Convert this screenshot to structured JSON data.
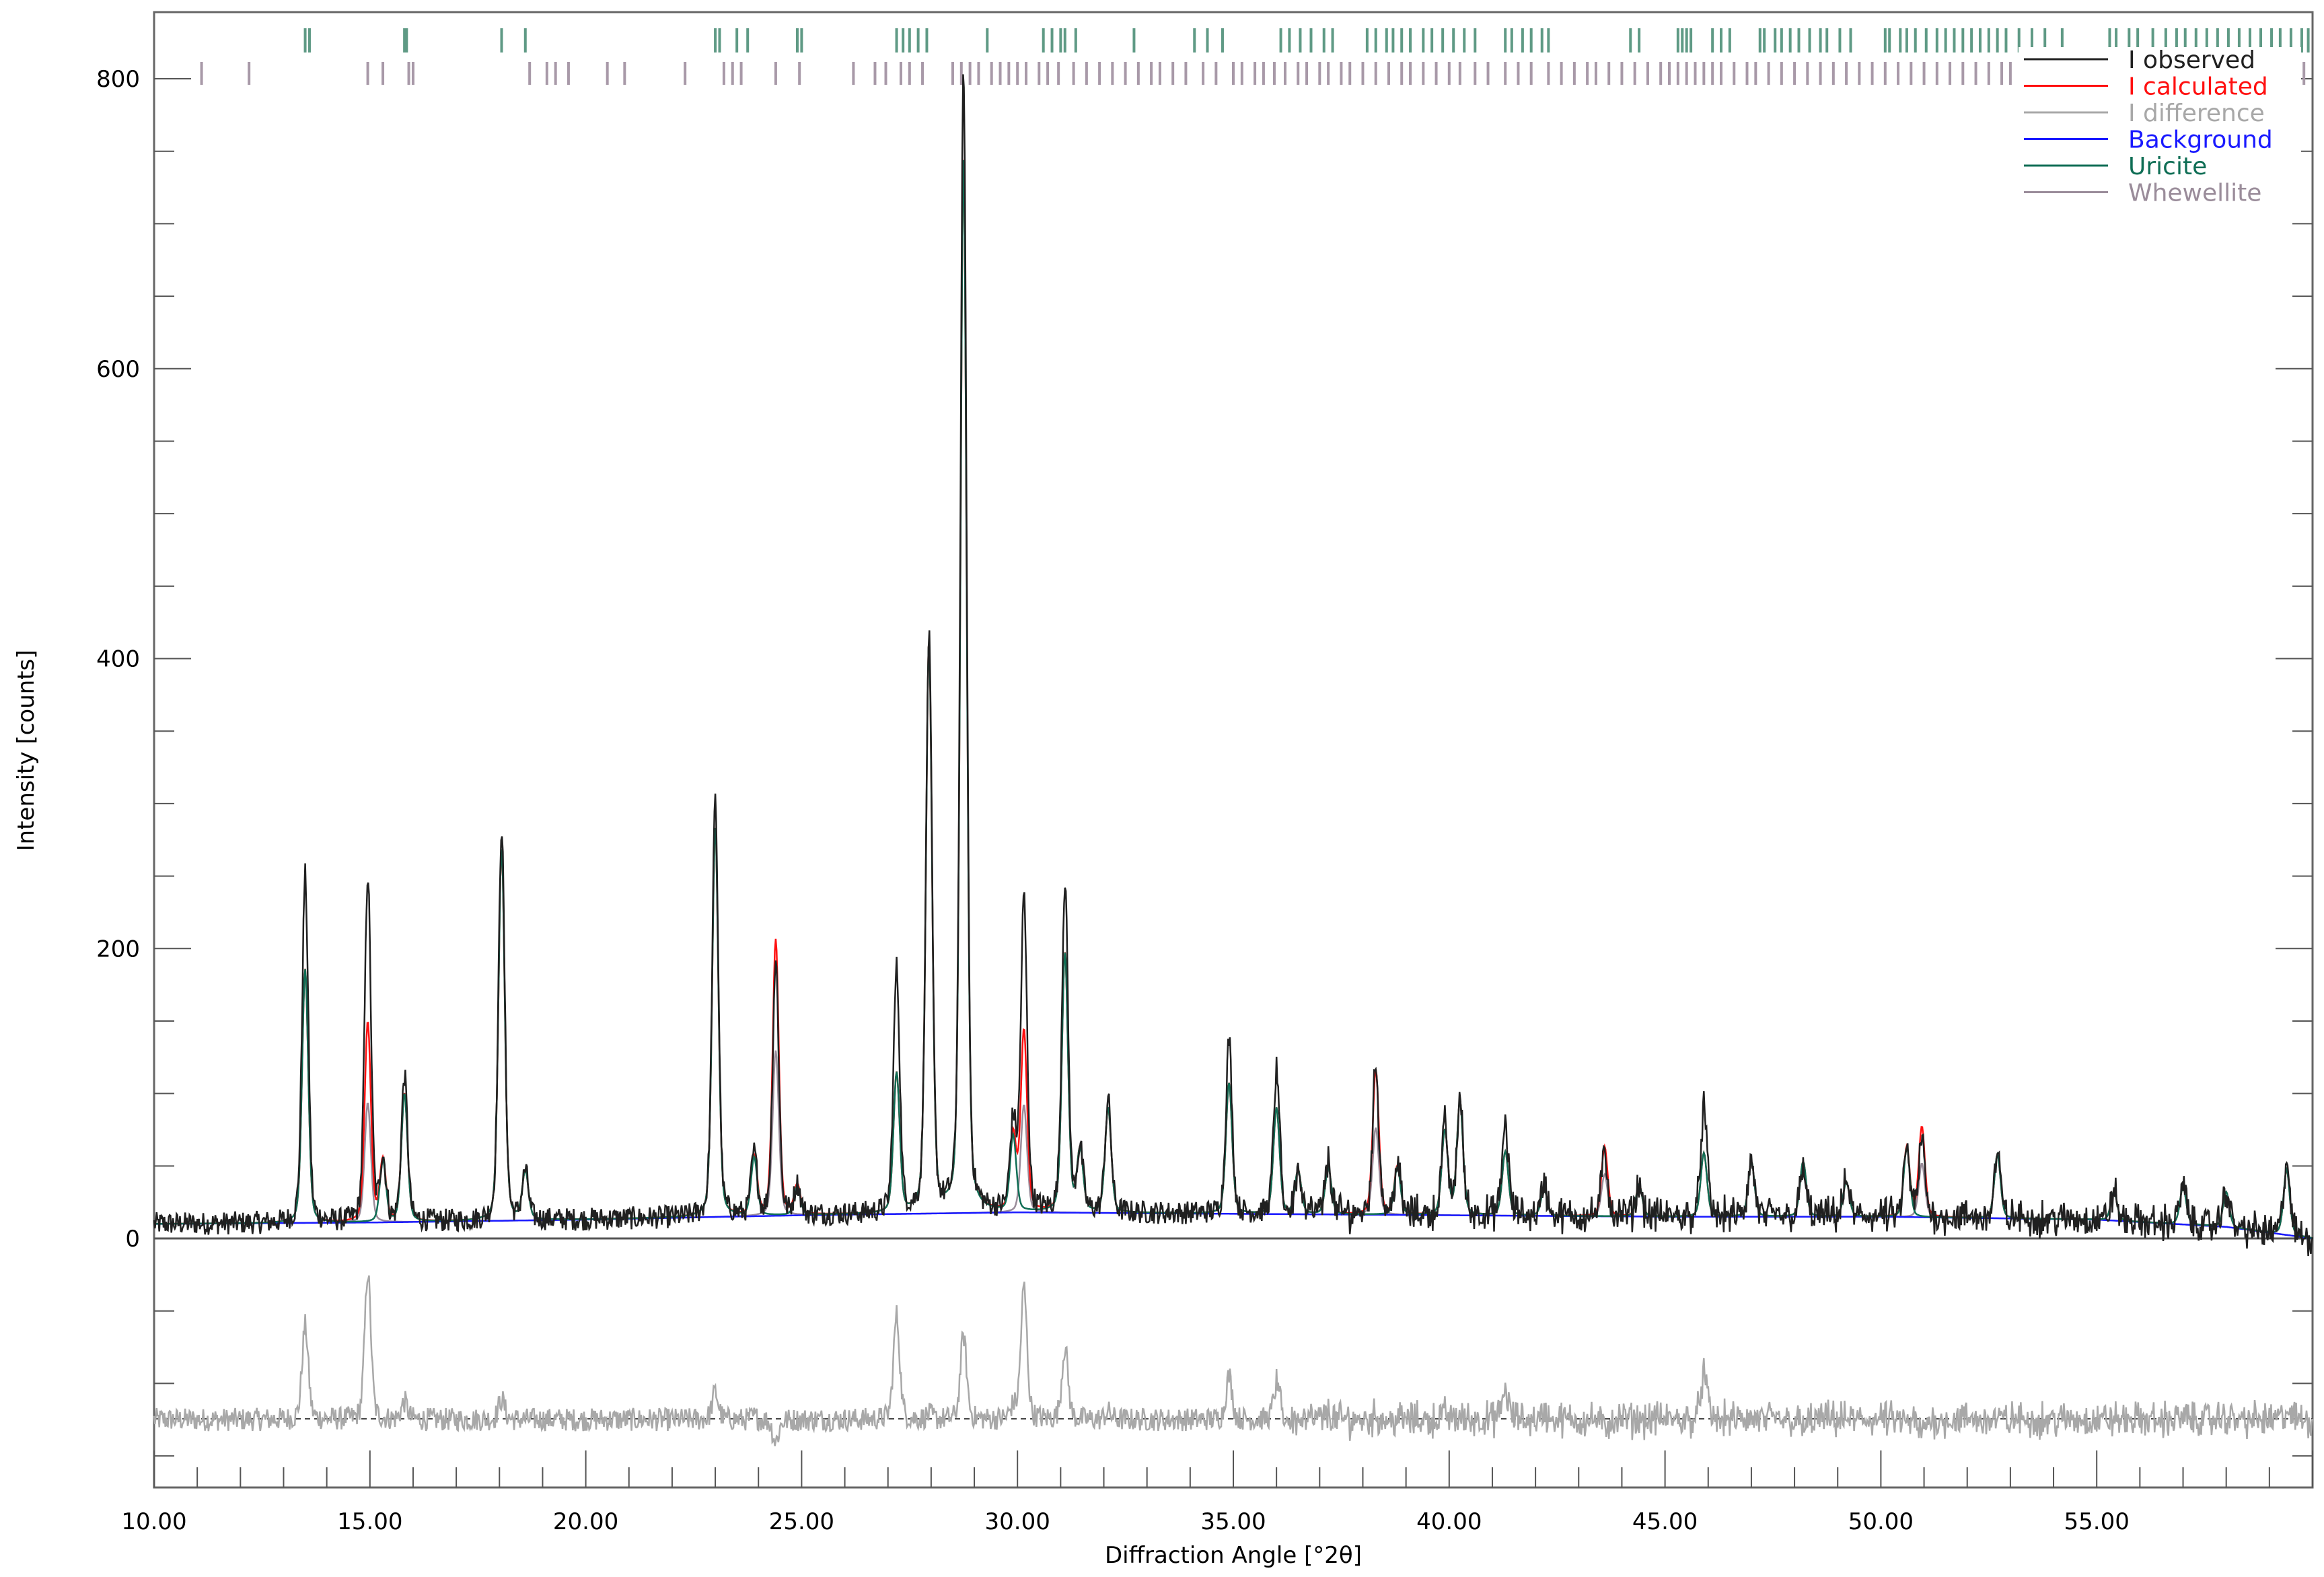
{
  "chart_data": {
    "type": "line",
    "title": "",
    "xlabel": "Diffraction Angle [°2θ]",
    "ylabel": "Intensity [counts]",
    "xlim": [
      10,
      60
    ],
    "ylim": [
      -175,
      845
    ],
    "x_ticks": [
      "10.00",
      "15.00",
      "20.00",
      "25.00",
      "30.00",
      "35.00",
      "40.00",
      "45.00",
      "50.00",
      "55.00"
    ],
    "x_tick_values": [
      10,
      15,
      20,
      25,
      30,
      35,
      40,
      45,
      50,
      55
    ],
    "y_ticks": [
      "0",
      "200",
      "400",
      "600",
      "800"
    ],
    "y_tick_values": [
      0,
      200,
      400,
      600,
      800
    ],
    "difference_offset": -125,
    "legend_position": "top-right",
    "legend": [
      {
        "key": "observed",
        "label": "I observed",
        "color": "#202020"
      },
      {
        "key": "calculated",
        "label": "I calculated",
        "color": "#ff1010"
      },
      {
        "key": "difference",
        "label": "I difference",
        "color": "#a8a8a8"
      },
      {
        "key": "background",
        "label": "Background",
        "color": "#1a1aff"
      },
      {
        "key": "uricite",
        "label": "Uricite",
        "color": "#0f6e55"
      },
      {
        "key": "whewellite",
        "label": "Whewellite",
        "color": "#9a8c9a"
      }
    ],
    "background_points": [
      [
        10,
        10
      ],
      [
        15,
        11
      ],
      [
        20,
        13
      ],
      [
        25,
        16
      ],
      [
        30,
        18
      ],
      [
        35,
        17
      ],
      [
        40,
        16
      ],
      [
        45,
        15
      ],
      [
        50,
        15
      ],
      [
        55,
        13
      ],
      [
        58,
        8
      ],
      [
        60,
        0
      ]
    ],
    "peak_width_deg": 0.085,
    "peaks": [
      {
        "pos": 13.5,
        "obs": 240,
        "calc": 175,
        "phase": "U"
      },
      {
        "pos": 14.95,
        "obs": 240,
        "calc": 138,
        "phase": "W"
      },
      {
        "pos": 15.3,
        "obs": 42,
        "calc": 42,
        "phase": "U"
      },
      {
        "pos": 15.8,
        "obs": 100,
        "calc": 88,
        "phase": "U"
      },
      {
        "pos": 18.05,
        "obs": 272,
        "calc": 258,
        "phase": "U"
      },
      {
        "pos": 18.6,
        "obs": 33,
        "calc": 33,
        "phase": "U"
      },
      {
        "pos": 23.0,
        "obs": 287,
        "calc": 268,
        "phase": "U"
      },
      {
        "pos": 23.9,
        "obs": 42,
        "calc": 40,
        "phase": "U"
      },
      {
        "pos": 24.4,
        "obs": 175,
        "calc": 190,
        "phase": "W"
      },
      {
        "pos": 24.9,
        "obs": 20,
        "calc": 20,
        "phase": "U"
      },
      {
        "pos": 27.2,
        "obs": 168,
        "calc": 96,
        "phase": "U"
      },
      {
        "pos": 27.95,
        "obs": 395,
        "calc": 392,
        "phase": "U"
      },
      {
        "pos": 28.75,
        "obs": 790,
        "calc": 732,
        "phase": "U"
      },
      {
        "pos": 29.9,
        "obs": 60,
        "calc": 52,
        "phase": "U"
      },
      {
        "pos": 30.15,
        "obs": 215,
        "calc": 124,
        "phase": "W"
      },
      {
        "pos": 31.1,
        "obs": 228,
        "calc": 178,
        "phase": "U"
      },
      {
        "pos": 31.45,
        "obs": 42,
        "calc": 42,
        "phase": "U"
      },
      {
        "pos": 32.1,
        "obs": 77,
        "calc": 72,
        "phase": "U"
      },
      {
        "pos": 34.9,
        "obs": 120,
        "calc": 90,
        "phase": "U"
      },
      {
        "pos": 36.0,
        "obs": 96,
        "calc": 73,
        "phase": "U"
      },
      {
        "pos": 36.5,
        "obs": 30,
        "calc": 30,
        "phase": "U"
      },
      {
        "pos": 37.2,
        "obs": 36,
        "calc": 32,
        "phase": "U"
      },
      {
        "pos": 38.3,
        "obs": 102,
        "calc": 100,
        "phase": "W"
      },
      {
        "pos": 38.8,
        "obs": 33,
        "calc": 33,
        "phase": "U"
      },
      {
        "pos": 39.9,
        "obs": 62,
        "calc": 58,
        "phase": "U"
      },
      {
        "pos": 40.25,
        "obs": 80,
        "calc": 78,
        "phase": "U"
      },
      {
        "pos": 41.3,
        "obs": 64,
        "calc": 44,
        "phase": "U"
      },
      {
        "pos": 42.2,
        "obs": 22,
        "calc": 18,
        "phase": "U"
      },
      {
        "pos": 43.6,
        "obs": 42,
        "calc": 48,
        "phase": "W"
      },
      {
        "pos": 44.4,
        "obs": 22,
        "calc": 22,
        "phase": "U"
      },
      {
        "pos": 45.9,
        "obs": 76,
        "calc": 44,
        "phase": "U"
      },
      {
        "pos": 47.0,
        "obs": 38,
        "calc": 38,
        "phase": "U"
      },
      {
        "pos": 48.2,
        "obs": 32,
        "calc": 38,
        "phase": "U"
      },
      {
        "pos": 49.2,
        "obs": 24,
        "calc": 24,
        "phase": "U"
      },
      {
        "pos": 50.6,
        "obs": 44,
        "calc": 48,
        "phase": "U"
      },
      {
        "pos": 50.95,
        "obs": 52,
        "calc": 62,
        "phase": "W"
      },
      {
        "pos": 52.7,
        "obs": 44,
        "calc": 44,
        "phase": "U"
      },
      {
        "pos": 55.4,
        "obs": 20,
        "calc": 20,
        "phase": "U"
      },
      {
        "pos": 57.0,
        "obs": 28,
        "calc": 26,
        "phase": "U"
      },
      {
        "pos": 58.0,
        "obs": 26,
        "calc": 24,
        "phase": "U"
      },
      {
        "pos": 59.4,
        "obs": 50,
        "calc": 45,
        "phase": "U"
      }
    ],
    "reflections": {
      "uricite": [
        13.5,
        13.6,
        15.8,
        15.85,
        18.05,
        18.6,
        23.0,
        23.1,
        23.5,
        23.75,
        24.9,
        25.0,
        27.2,
        27.35,
        27.5,
        27.7,
        27.9,
        29.3,
        30.6,
        30.8,
        31.0,
        31.1,
        31.35,
        32.7,
        34.1,
        34.4,
        34.75,
        36.1,
        36.3,
        36.55,
        36.8,
        37.1,
        37.3,
        38.1,
        38.3,
        38.55,
        38.7,
        38.9,
        39.1,
        39.4,
        39.6,
        39.85,
        40.1,
        40.35,
        40.6,
        41.3,
        41.45,
        41.7,
        41.9,
        42.15,
        42.3,
        44.2,
        44.4,
        45.3,
        45.4,
        45.5,
        45.6,
        46.1,
        46.3,
        46.5,
        47.2,
        47.3,
        47.55,
        47.7,
        47.9,
        48.1,
        48.35,
        48.6,
        48.75,
        49.05,
        49.3,
        50.1,
        50.2,
        50.45,
        50.6,
        50.8,
        51.05,
        51.3,
        51.5,
        51.7,
        51.9,
        52.1,
        52.3,
        52.5,
        52.7,
        52.9,
        53.2,
        53.5,
        53.8,
        54.2,
        55.3,
        55.45,
        55.75,
        55.95,
        56.3,
        56.6,
        56.85,
        57.05,
        57.3,
        57.55,
        57.8,
        58.05,
        58.3,
        58.55,
        58.8,
        59.05,
        59.25,
        59.5,
        59.75,
        59.9
      ],
      "whewellite": [
        11.1,
        12.2,
        14.95,
        15.3,
        15.9,
        16.0,
        18.7,
        19.1,
        19.3,
        19.6,
        20.5,
        20.9,
        22.3,
        23.2,
        23.4,
        23.6,
        24.4,
        24.95,
        26.2,
        26.7,
        26.95,
        27.3,
        27.5,
        27.8,
        28.5,
        28.7,
        28.9,
        29.1,
        29.4,
        29.6,
        29.8,
        30.0,
        30.2,
        30.5,
        30.7,
        30.95,
        31.3,
        31.6,
        31.9,
        32.2,
        32.5,
        32.8,
        33.1,
        33.3,
        33.6,
        33.9,
        34.3,
        34.6,
        35.0,
        35.2,
        35.5,
        35.7,
        35.95,
        36.2,
        36.5,
        36.7,
        37.0,
        37.2,
        37.5,
        37.7,
        38.0,
        38.3,
        38.6,
        38.9,
        39.1,
        39.4,
        39.7,
        40.0,
        40.25,
        40.6,
        40.9,
        41.3,
        41.6,
        41.9,
        42.3,
        42.6,
        42.9,
        43.2,
        43.4,
        43.7,
        44.0,
        44.3,
        44.6,
        44.9,
        45.1,
        45.3,
        45.5,
        45.7,
        45.9,
        46.1,
        46.3,
        46.6,
        46.9,
        47.1,
        47.4,
        47.7,
        48.0,
        48.3,
        48.6,
        48.9,
        49.2,
        49.5,
        49.8,
        50.1,
        50.4,
        50.7,
        51.0,
        51.3,
        51.6,
        51.9,
        52.2,
        52.5,
        52.8,
        53.0,
        53.3,
        53.6,
        59.6,
        59.8
      ]
    }
  }
}
